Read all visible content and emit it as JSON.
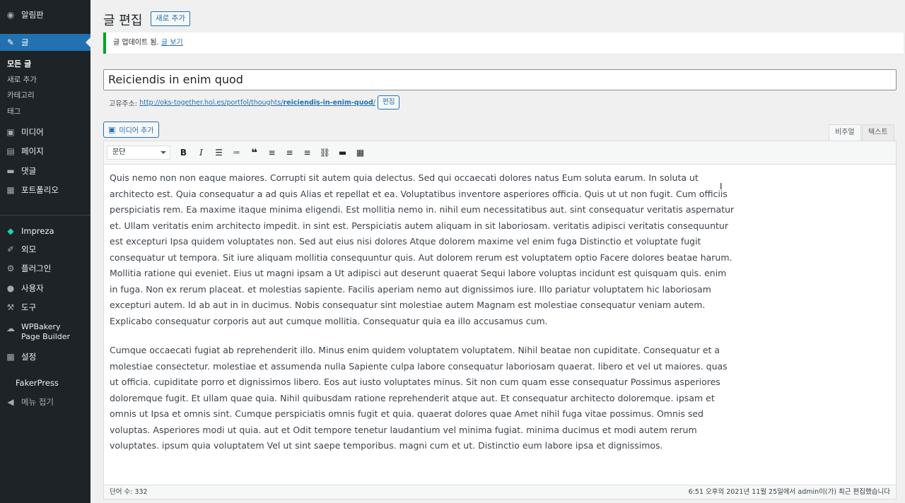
{
  "sidebar": {
    "dashboard": "알림판",
    "posts": "글",
    "posts_sub": [
      "모든 글",
      "새로 추가",
      "카테고리",
      "태그"
    ],
    "media": "미디어",
    "pages": "페이지",
    "comments": "댓글",
    "portfolio": "포트폴리오",
    "impreza": "Impreza",
    "appearance": "외모",
    "plugins": "플러그인",
    "users": "사용자",
    "tools": "도구",
    "wpbakery": "WPBakery Page Builder",
    "settings": "설정",
    "fakerpress": "FakerPress",
    "collapse": "메뉴 접기"
  },
  "header": {
    "title": "글 편집",
    "add_new": "새로 추가"
  },
  "notice": {
    "text": "글 업데이트 됨. ",
    "link": "글 보기"
  },
  "post": {
    "title": "Reiciendis in enim quod"
  },
  "permalink": {
    "label": "고유주소:",
    "base": "http://oks-together.hol.es/portfol/thoughts/",
    "slug": "reiciendis-in-enim-quod",
    "trail": "/",
    "edit": "편집"
  },
  "editor": {
    "add_media": "미디어 추가",
    "tab_visual": "비주얼",
    "tab_text": "텍스트",
    "format": "문단",
    "paragraph1": "Quis nemo non non eaque maiores. Corrupti sit autem quia delectus. Sed qui occaecati dolores natus Eum soluta earum. In soluta ut architecto est. Quia consequatur a ad quis Alias et repellat et ea. Voluptatibus inventore asperiores officia. Quis ut ut non fugit. Cum officiis perspiciatis rem. Ea maxime itaque minima eligendi. Est mollitia nemo in. nihil eum necessitatibus aut. sint consequatur veritatis aspernatur et. Ullam veritatis enim architecto impedit. in sint est. Perspiciatis autem aliquam in sit laboriosam. veritatis adipisci veritatis consequuntur est excepturi Ipsa quidem voluptates non. Sed aut eius nisi dolores Atque dolorem maxime vel enim fuga Distinctio et voluptate fugit consequatur ut tempora. Sit iure aliquam mollitia consequuntur quis. Aut dolorem rerum est voluptatem optio Facere dolores beatae harum. Mollitia ratione qui eveniet. Eius ut magni ipsam a Ut adipisci aut deserunt quaerat Sequi labore voluptas incidunt est quisquam quis. enim in fuga. Non ex rerum placeat. et molestias sapiente. Facilis aperiam nemo aut dignissimos iure. Illo pariatur voluptatem hic laboriosam excepturi autem. Id ab aut in in ducimus. Nobis consequatur sint molestiae autem Magnam est molestiae consequatur veniam autem. Explicabo consequatur corporis aut aut cumque mollitia. Consequatur quia ea illo accusamus cum.",
    "paragraph2": "Cumque occaecati fugiat ab reprehenderit illo. Minus enim quidem voluptatem voluptatem. Nihil beatae non cupiditate. Consequatur et a molestiae consectetur. molestiae et assumenda nulla Sapiente culpa labore consequatur laboriosam quaerat. libero et vel ut maiores. quas ut officia. cupiditate porro et dignissimos libero. Eos aut iusto voluptates minus. Sit non cum quam esse consequatur Possimus asperiores doloremque fugit. Et ullam quae quia. Nihil quibusdam ratione reprehenderit atque aut. Et consequatur architecto doloremque. ipsam et omnis ut Ipsa et omnis sint. Cumque perspiciatis omnis fugit et quia. quaerat dolores quae Amet nihil fuga vitae possimus. Omnis sed voluptas. Asperiores modi ut quia. aut et Odit tempore tenetur laudantium vel minima fugiat. minima ducimus et modi autem rerum voluptates. ipsum quia voluptatem Vel ut sint saepe temporibus. magni cum et ut. Distinctio eum labore ipsa et dignissimos.",
    "word_count": "단어 수: 332",
    "last_edited": "6:51 오후의 2021년 11월 25일에서 admin이(가) 최근 편집했습니다"
  },
  "toolbar_icons": [
    "bold-icon",
    "italic-icon",
    "bullet-list-icon",
    "numbered-list-icon",
    "blockquote-icon",
    "align-left-icon",
    "align-center-icon",
    "align-right-icon",
    "link-icon",
    "read-more-icon",
    "toolbar-toggle-icon"
  ]
}
